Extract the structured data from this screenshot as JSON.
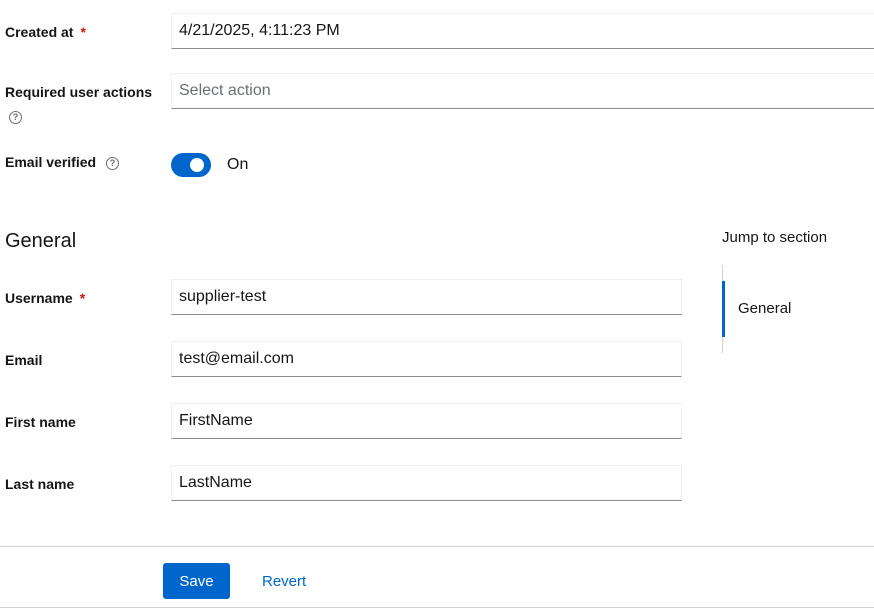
{
  "form": {
    "created_at": {
      "label": "Created at",
      "required": "*",
      "value": "4/21/2025, 4:11:23 PM"
    },
    "required_actions": {
      "label": "Required user actions",
      "placeholder": "Select action",
      "help_icon": "question-circle-icon"
    },
    "email_verified": {
      "label": "Email verified",
      "help_icon": "question-circle-icon",
      "state": "On",
      "on": true
    }
  },
  "general": {
    "title": "General",
    "username": {
      "label": "Username",
      "required": "*",
      "value": "supplier-test"
    },
    "email": {
      "label": "Email",
      "value": "test@email.com"
    },
    "first_name": {
      "label": "First name",
      "value": "FirstName"
    },
    "last_name": {
      "label": "Last name",
      "value": "LastName"
    }
  },
  "jump": {
    "title": "Jump to section",
    "items": [
      {
        "label": "General",
        "active": true
      }
    ]
  },
  "footer": {
    "save_label": "Save",
    "revert_label": "Revert"
  },
  "colors": {
    "accent": "#0066cc",
    "required": "#c9190b"
  }
}
